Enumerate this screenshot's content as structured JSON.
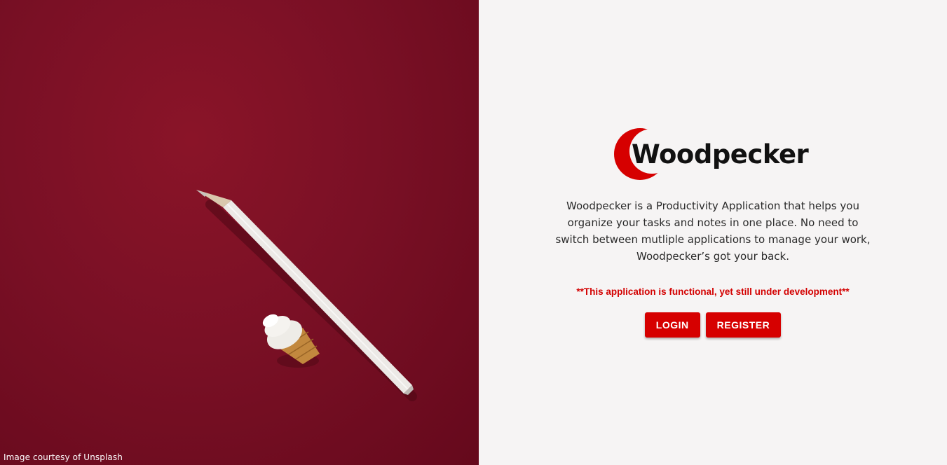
{
  "photo": {
    "credit": "Image courtesy of Unsplash",
    "background_color": "#7a1025"
  },
  "brand": {
    "name": "Woodpecker",
    "logo_icon": "red-crescent-logo-icon",
    "accent_color": "#d60000"
  },
  "main": {
    "description": "Woodpecker is a Productivity Application that helps you organize your tasks and notes in one place. No need to switch between mutliple applications to manage your work, Woodpecker’s got your back.",
    "notice": "**This application is functional, yet still under development**"
  },
  "actions": {
    "login_label": "LOGIN",
    "register_label": "REGISTER"
  }
}
